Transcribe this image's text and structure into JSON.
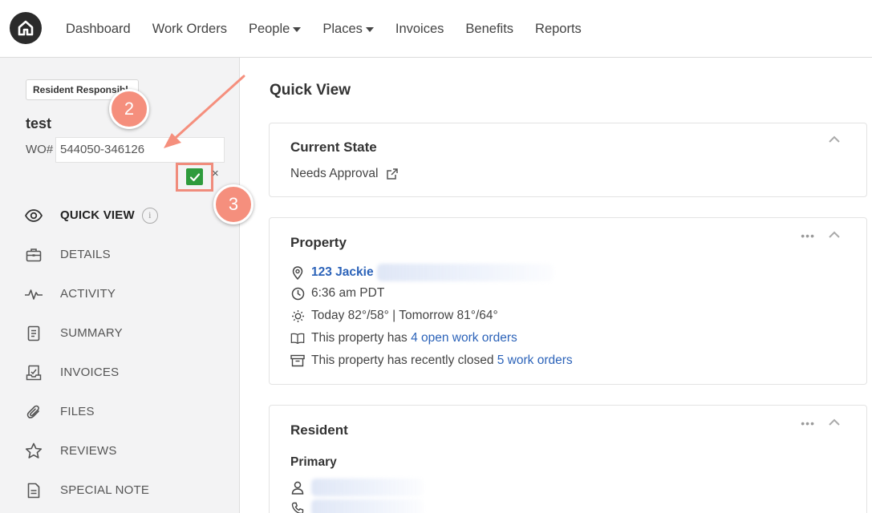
{
  "nav": {
    "items": [
      {
        "label": "Dashboard",
        "dropdown": false
      },
      {
        "label": "Work Orders",
        "dropdown": false
      },
      {
        "label": "People",
        "dropdown": true
      },
      {
        "label": "Places",
        "dropdown": true
      },
      {
        "label": "Invoices",
        "dropdown": false
      },
      {
        "label": "Benefits",
        "dropdown": false
      },
      {
        "label": "Reports",
        "dropdown": false
      }
    ]
  },
  "sidebar": {
    "badge": "Resident Responsibl",
    "title": "test",
    "wo_label": "WO#",
    "wo_value": "544050-346126",
    "cancel_label": "×",
    "menu": [
      {
        "label": "QUICK VIEW",
        "icon": "eye-icon",
        "active": true
      },
      {
        "label": "DETAILS",
        "icon": "briefcase-icon",
        "active": false
      },
      {
        "label": "ACTIVITY",
        "icon": "activity-icon",
        "active": false
      },
      {
        "label": "SUMMARY",
        "icon": "document-icon",
        "active": false
      },
      {
        "label": "INVOICES",
        "icon": "invoice-icon",
        "active": false
      },
      {
        "label": "FILES",
        "icon": "paperclip-icon",
        "active": false
      },
      {
        "label": "REVIEWS",
        "icon": "star-icon",
        "active": false
      },
      {
        "label": "SPECIAL NOTE",
        "icon": "note-icon",
        "active": false
      }
    ]
  },
  "annotations": {
    "step2": "2",
    "step3": "3",
    "marker_color": "#f58f7d"
  },
  "main": {
    "title": "Quick View",
    "current_state": {
      "title": "Current State",
      "value": "Needs Approval"
    },
    "property": {
      "title": "Property",
      "address": "123 Jackie",
      "time": "6:36 am PDT",
      "weather": "Today 82°/58° | Tomorrow 81°/64°",
      "open_prefix": "This property has ",
      "open_link": "4 open work orders",
      "closed_prefix": "This property has recently closed ",
      "closed_link": "5 work orders"
    },
    "resident": {
      "title": "Resident",
      "primary_label": "Primary"
    }
  },
  "colors": {
    "link": "#2c63b9",
    "confirm_green": "#2e9b3c",
    "highlight": "#f08c7c"
  }
}
